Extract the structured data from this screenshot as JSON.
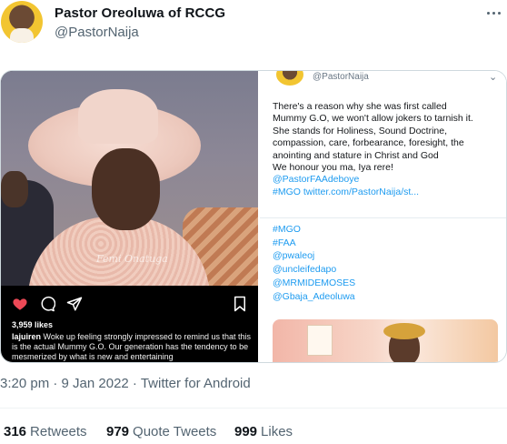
{
  "author": {
    "display_name": "Pastor Oreoluwa of RCCG",
    "handle": "@PastorNaija"
  },
  "media": {
    "instagram": {
      "watermark": "Femi Onatuga",
      "likes": "3,959 likes",
      "caption_user": "lajuiren",
      "caption_text": "Woke up feeling strongly impressed to remind us that this is the actual Mummy G.O. Our generation has the tendency to be mesmerized by what is new and entertaining"
    },
    "embedded_tweet": {
      "handle": "@PastorNaija",
      "text_lines": [
        "There's a reason why she was first called",
        "Mummy G.O, we won't allow jokers to tarnish it.",
        "She stands for Holiness, Sound Doctrine,",
        "compassion, care, forbearance, foresight, the",
        "anointing and stature in Christ and God",
        "We honour you ma, Iya rere!"
      ],
      "link_lines": [
        "@PastorFAAdeboye",
        "#MGO twitter.com/PastorNaija/st..."
      ],
      "list_lines": [
        "#MGO",
        "#FAA",
        "@pwaleoj",
        "@uncleifedapo",
        "@MRMIDEMOSES",
        "@Gbaja_Adeoluwa"
      ]
    }
  },
  "timestamp": "3:20 pm · 9 Jan 2022 · Twitter for Android",
  "stats": {
    "retweets_count": "316",
    "retweets_label": "Retweets",
    "quotes_count": "979",
    "quotes_label": "Quote Tweets",
    "likes_count": "999",
    "likes_label": "Likes"
  },
  "colors": {
    "link": "#1d9bf0",
    "secondary_text": "#536471",
    "instagram_like": "#ed4956"
  },
  "icons": [
    "more-icon",
    "heart-icon",
    "comment-icon",
    "share-icon",
    "bookmark-icon",
    "chevron-down-icon"
  ]
}
